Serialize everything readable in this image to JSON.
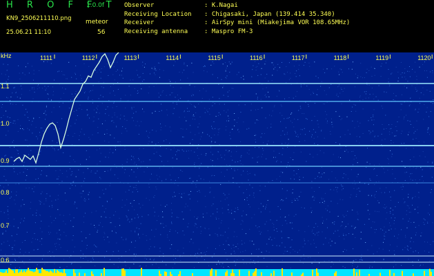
{
  "header": {
    "app_name": "H R O F F T",
    "version": "1.0.0f",
    "filename": "KN9_2506211110.png",
    "meteor_label": "meteor",
    "datetime": "25.06.21 11:10",
    "meteor_count": "56"
  },
  "meta": [
    {
      "key": "Observer",
      "value": ": K.Nagai"
    },
    {
      "key": "Receiving Location",
      "value": ": Chigasaki, Japan (139.414 35.340)"
    },
    {
      "key": "Receiver",
      "value": ": AirSpy mini (Miakejima VOR 108.65MHz)"
    },
    {
      "key": "Receiving antenna",
      "value": ": Maspro FM-3"
    }
  ],
  "spectrogram": {
    "y_unit": "kHz",
    "y_ticks": [
      "1.1",
      "1.0",
      "0.9",
      "0.8",
      "0.7",
      "0.6"
    ],
    "x_ticks": [
      "1111",
      "1112",
      "1113",
      "1114",
      "1115",
      "1116",
      "1117",
      "1118",
      "1119",
      "1120"
    ],
    "colors": {
      "background": "#00208c",
      "noise": "#2f6bd8",
      "carrier": "#9be8ff",
      "trace": "#d8ffe0",
      "bottom_bar": "#00e5ff",
      "bottom_peaks": "#ffe800"
    }
  }
}
